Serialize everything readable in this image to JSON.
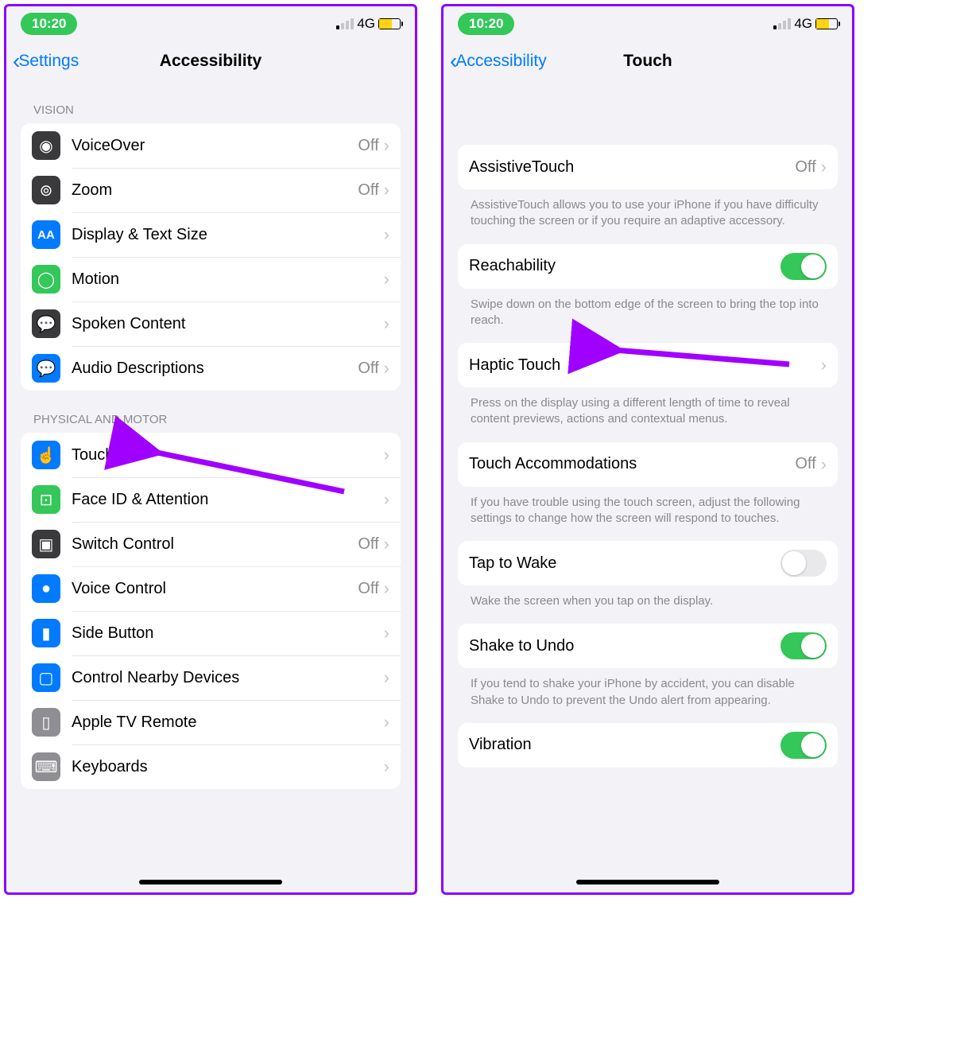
{
  "status": {
    "time": "10:20",
    "network": "4G"
  },
  "left": {
    "back": "Settings",
    "title": "Accessibility",
    "sections": [
      {
        "header": "VISION",
        "rows": [
          {
            "label": "VoiceOver",
            "value": "Off",
            "icon": "voiceover",
            "bg": "#3a3a3c"
          },
          {
            "label": "Zoom",
            "value": "Off",
            "icon": "zoom",
            "bg": "#3a3a3c"
          },
          {
            "label": "Display & Text Size",
            "value": "",
            "icon": "textsize",
            "bg": "#007aff"
          },
          {
            "label": "Motion",
            "value": "",
            "icon": "motion",
            "bg": "#34c759"
          },
          {
            "label": "Spoken Content",
            "value": "",
            "icon": "spoken",
            "bg": "#3a3a3c"
          },
          {
            "label": "Audio Descriptions",
            "value": "Off",
            "icon": "audiodesc",
            "bg": "#007aff"
          }
        ]
      },
      {
        "header": "PHYSICAL AND MOTOR",
        "rows": [
          {
            "label": "Touch",
            "value": "",
            "icon": "touch",
            "bg": "#007aff"
          },
          {
            "label": "Face ID & Attention",
            "value": "",
            "icon": "faceid",
            "bg": "#34c759"
          },
          {
            "label": "Switch Control",
            "value": "Off",
            "icon": "switch",
            "bg": "#3a3a3c"
          },
          {
            "label": "Voice Control",
            "value": "Off",
            "icon": "voicecontrol",
            "bg": "#007aff"
          },
          {
            "label": "Side Button",
            "value": "",
            "icon": "sidebutton",
            "bg": "#007aff"
          },
          {
            "label": "Control Nearby Devices",
            "value": "",
            "icon": "nearby",
            "bg": "#007aff"
          },
          {
            "label": "Apple TV Remote",
            "value": "",
            "icon": "tvremote",
            "bg": "#8e8e93"
          },
          {
            "label": "Keyboards",
            "value": "",
            "icon": "keyboard",
            "bg": "#8e8e93"
          }
        ]
      }
    ]
  },
  "right": {
    "back": "Accessibility",
    "title": "Touch",
    "items": [
      {
        "label": "AssistiveTouch",
        "value": "Off",
        "chev": true,
        "footer": "AssistiveTouch allows you to use your iPhone if you have difficulty touching the screen or if you require an adaptive accessory."
      },
      {
        "label": "Reachability",
        "toggle": "on",
        "footer": "Swipe down on the bottom edge of the screen to bring the top into reach."
      },
      {
        "label": "Haptic Touch",
        "value": "",
        "chev": true,
        "footer": "Press on the display using a different length of time to reveal content previews, actions and contextual menus."
      },
      {
        "label": "Touch Accommodations",
        "value": "Off",
        "chev": true,
        "footer": "If you have trouble using the touch screen, adjust the following settings to change how the screen will respond to touches."
      },
      {
        "label": "Tap to Wake",
        "toggle": "off",
        "footer": "Wake the screen when you tap on the display."
      },
      {
        "label": "Shake to Undo",
        "toggle": "on",
        "footer": "If you tend to shake your iPhone by accident, you can disable Shake to Undo to prevent the Undo alert from appearing."
      },
      {
        "label": "Vibration",
        "toggle": "on",
        "footer": ""
      }
    ]
  },
  "icons": {
    "voiceover": "◉",
    "zoom": "⊚",
    "textsize": "AA",
    "motion": "◯",
    "spoken": "💬",
    "audiodesc": "💬",
    "touch": "☝",
    "faceid": "⊡",
    "switch": "▣",
    "voicecontrol": "●",
    "sidebutton": "▮",
    "nearby": "▢",
    "tvremote": "▯",
    "keyboard": "⌨"
  }
}
